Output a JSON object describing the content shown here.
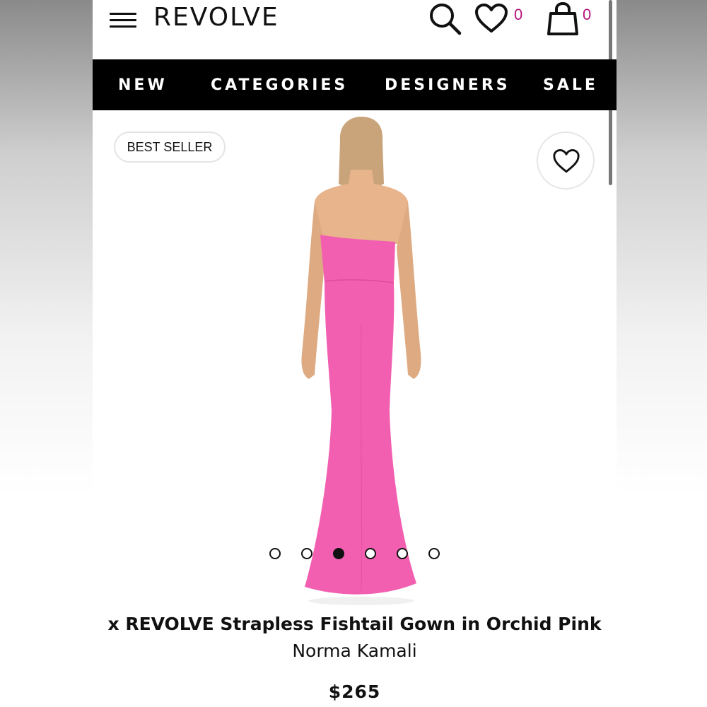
{
  "header": {
    "logo": "REVOLVE",
    "wishlist_count": "0",
    "bag_count": "0"
  },
  "nav": {
    "items": [
      "NEW",
      "CATEGORIES",
      "DESIGNERS",
      "SALE"
    ]
  },
  "product": {
    "badge": "BEST SELLER",
    "title": "x REVOLVE Strapless Fishtail Gown in Orchid Pink",
    "brand": "Norma Kamali",
    "price": "$265",
    "image_count": 6,
    "active_image_index": 2
  },
  "colors": {
    "accent_count": "#b5157a",
    "gown": "#f25fb0",
    "nav_bg": "#000000"
  },
  "icons": [
    "menu-icon",
    "search-icon",
    "heart-icon",
    "bag-icon",
    "favorite-heart-icon"
  ]
}
